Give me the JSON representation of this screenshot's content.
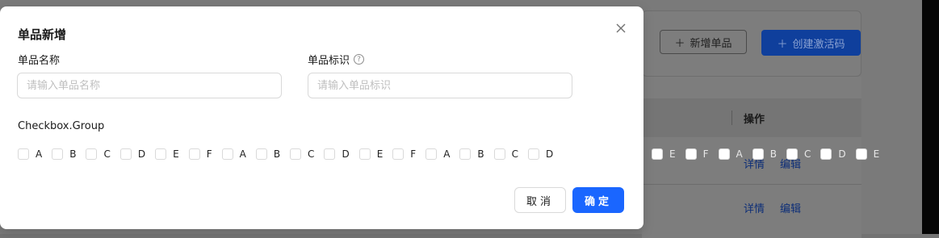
{
  "background": {
    "add_item_button": "新增单品",
    "create_code_button": "创建激活码",
    "table_header_action": "操作",
    "rows": [
      {
        "detail": "详情",
        "edit": "编辑"
      },
      {
        "detail": "详情",
        "edit": "编辑"
      }
    ]
  },
  "modal": {
    "title": "单品新增",
    "name_label": "单品名称",
    "name_placeholder": "请输入单品名称",
    "id_label": "单品标识",
    "id_placeholder": "请输入单品标识",
    "help_icon_glyph": "?",
    "group_label": "Checkbox.Group",
    "options": [
      "A",
      "B",
      "C",
      "D",
      "E",
      "F",
      "A",
      "B",
      "C",
      "D",
      "E",
      "F",
      "A",
      "B",
      "C",
      "D",
      "E",
      "F",
      "A",
      "B",
      "C",
      "D",
      "E"
    ],
    "cancel_label": "取消",
    "ok_label": "确定"
  }
}
